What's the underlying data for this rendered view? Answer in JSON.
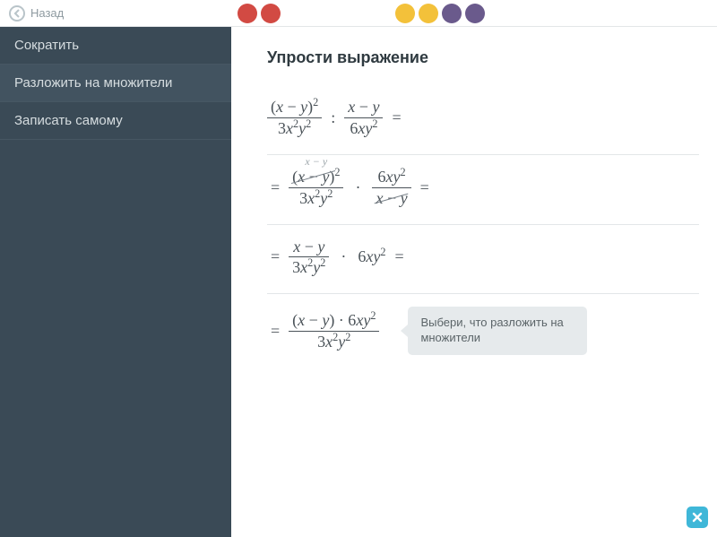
{
  "topbar": {
    "back_label": "Назад",
    "dots": [
      {
        "color": "#d24a43"
      },
      {
        "color": "#d24a43"
      },
      {
        "color": "#f3c13a"
      },
      {
        "color": "#f3c13a"
      },
      {
        "color": "#6a5a8c"
      },
      {
        "color": "#6a5a8c"
      }
    ]
  },
  "sidebar": {
    "items": [
      {
        "label": "Сократить",
        "selected": false
      },
      {
        "label": "Разложить на множители",
        "selected": true
      },
      {
        "label": "Записать самому",
        "selected": false
      }
    ]
  },
  "content": {
    "title": "Упрости выражение",
    "steps": {
      "s1": {
        "f1_num": "(x − y)²",
        "f1_den": "3x²y²",
        "op": ":",
        "f2_num": "x − y",
        "f2_den": "6xy²",
        "tail": "="
      },
      "s2": {
        "lead": "=",
        "cancel_note": "x − y",
        "f1_num": "(x − y)²",
        "f1_den": "3x²y²",
        "op": "·",
        "f2_num": "6xy²",
        "f2_den": "x − y",
        "tail": "="
      },
      "s3": {
        "lead": "=",
        "f1_num": "x − y",
        "f1_den": "3x²y²",
        "op": "·",
        "rhs": "6xy²",
        "tail": "="
      },
      "s4": {
        "lead": "=",
        "num": "(x − y) · 6xy²",
        "den": "3x²y²"
      }
    },
    "hint": "Выбери, что разложить на множители"
  },
  "icons": {
    "back": "chevron-left-icon",
    "close": "close-icon"
  }
}
